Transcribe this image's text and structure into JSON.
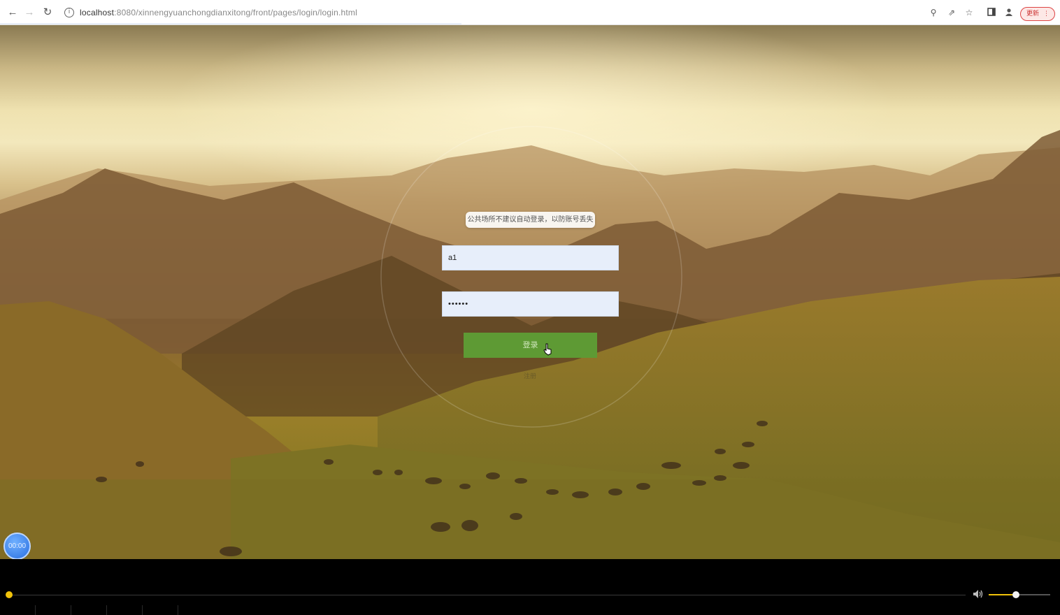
{
  "browser": {
    "url_host": "localhost",
    "url_path": ":8080/xinnengyuanchongdianxitong/front/pages/login/login.html",
    "update_label": "更新",
    "colors": {
      "accent_red": "#d44444"
    }
  },
  "page": {
    "notice": "公共场所不建议自动登录，以防账号丢失",
    "username_value": "a1",
    "password_value": "••••••",
    "login_label": "登录",
    "register_label": "注册",
    "clock_text": "00:00",
    "colors": {
      "login_button": "#5e9a34",
      "field_bg": "#e7eefa"
    }
  },
  "player": {
    "progress": 0,
    "volume": 0.45,
    "colors": {
      "accent": "#f0c20a"
    }
  },
  "icons": [
    "back-icon",
    "forward-icon",
    "reload-icon",
    "site-info-icon",
    "key-icon",
    "share-icon",
    "star-icon",
    "sidepanel-icon",
    "profile-icon",
    "menu-dots-icon",
    "cursor-icon",
    "volume-icon"
  ]
}
